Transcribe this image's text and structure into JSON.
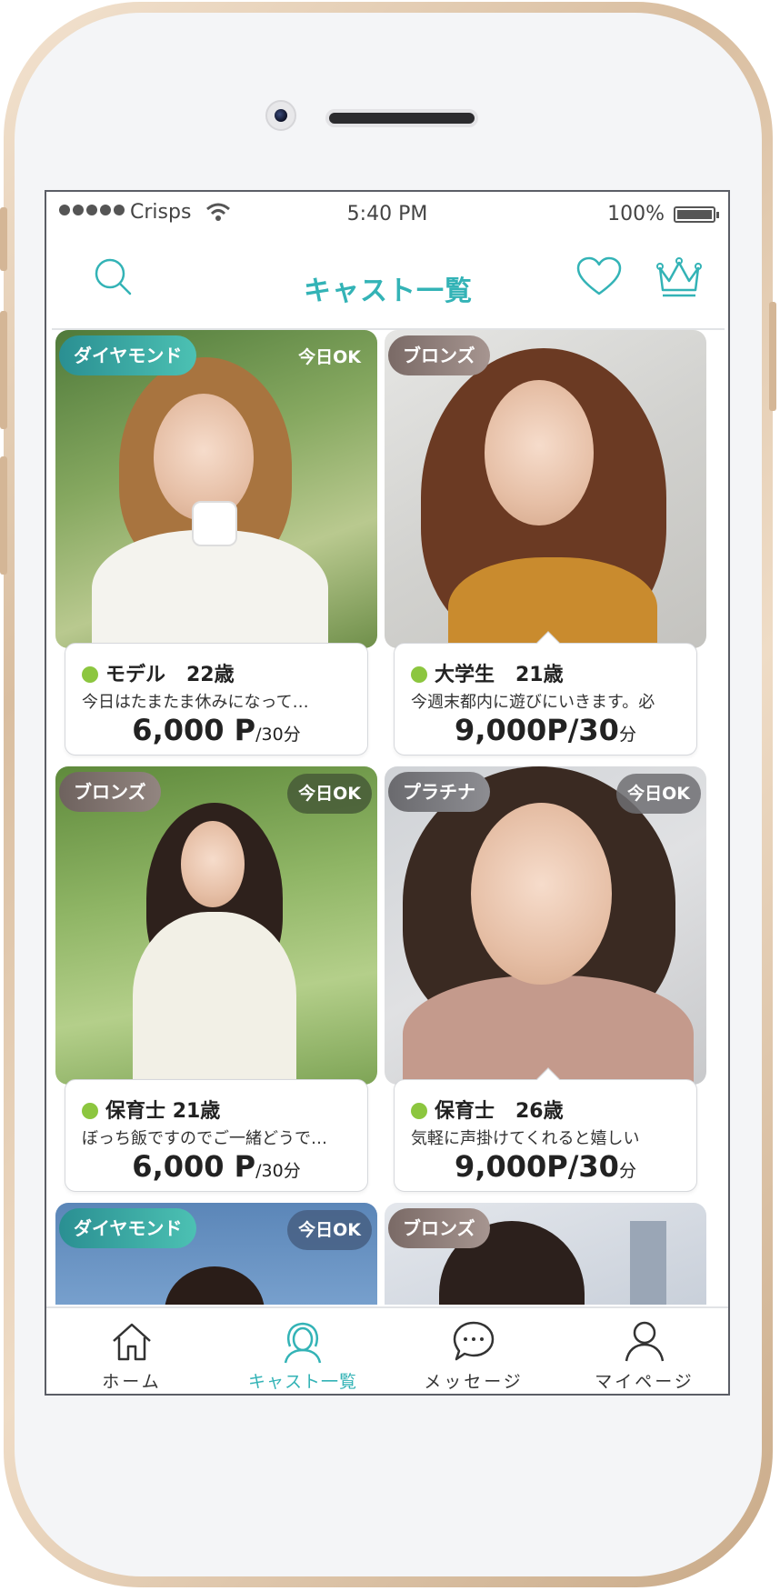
{
  "colors": {
    "accent": "#33b3b6",
    "online": "#8cc63f"
  },
  "status_bar": {
    "carrier": "Crisps",
    "time": "5:40 PM",
    "battery": "100%"
  },
  "header": {
    "title": "キャスト一覧",
    "left_icon": "search-icon",
    "right_icons": [
      "heart-icon",
      "crown-icon"
    ]
  },
  "casts": [
    {
      "rank": "ダイヤモンド",
      "today": "今日OK",
      "job": "モデル",
      "age": "22歳",
      "message": "今日はたまたま休みになって…",
      "price": "6,000 P",
      "unit": "/30分"
    },
    {
      "rank": "ブロンズ",
      "today": "",
      "job": "大学生",
      "age": "21歳",
      "message": "今週末都内に遊びにいきます。必",
      "price": "9,000P/30",
      "unit": "分"
    },
    {
      "rank": "ブロンズ",
      "today": "今日OK",
      "job": "保育士",
      "age": "21歳",
      "message": "ぼっち飯ですのでご一緒どうで…",
      "price": "6,000 P",
      "unit": "/30分"
    },
    {
      "rank": "プラチナ",
      "today": "今日OK",
      "job": "保育士",
      "age": "26歳",
      "message": "気軽に声掛けてくれると嬉しい",
      "price": "9,000P/30",
      "unit": "分"
    },
    {
      "rank": "ダイヤモンド",
      "today": "今日OK"
    },
    {
      "rank": "ブロンズ",
      "today": ""
    }
  ],
  "tabs": [
    {
      "label": "ホーム",
      "icon": "home-icon"
    },
    {
      "label": "キャスト一覧",
      "icon": "cast-icon",
      "active": true
    },
    {
      "label": "メッセージ",
      "icon": "message-icon"
    },
    {
      "label": "マイページ",
      "icon": "user-icon"
    }
  ]
}
